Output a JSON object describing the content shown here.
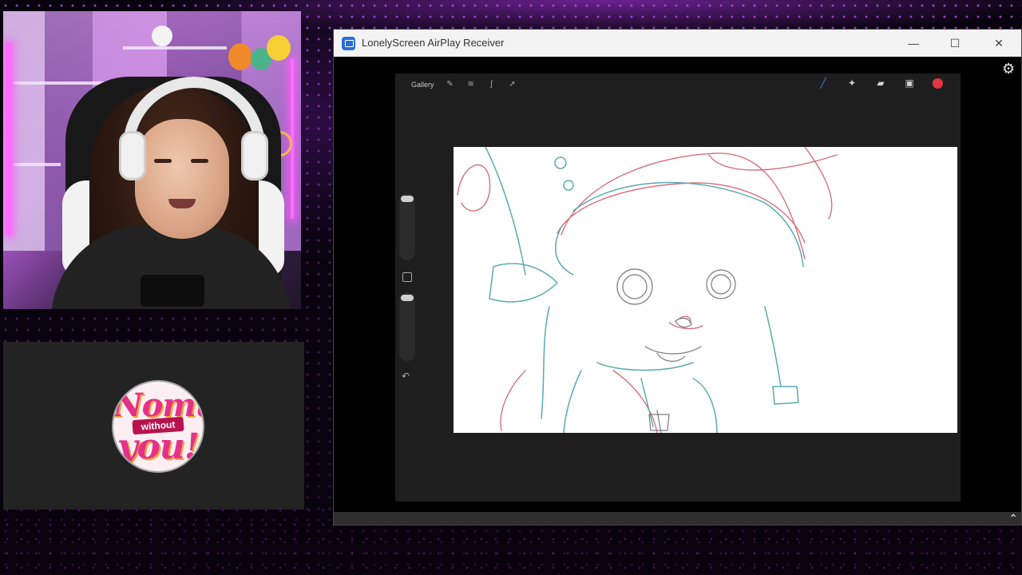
{
  "window": {
    "title": "LonelyScreen AirPlay Receiver",
    "controls": {
      "minimize": "—",
      "maximize": "☐",
      "close": "✕"
    }
  },
  "procreate": {
    "gallery_label": "Gallery",
    "selected_color": "#e2363e",
    "accent_color": "#3d7be8"
  },
  "logo": {
    "top": "Nomu",
    "middle": "without",
    "bottom": "you!"
  },
  "icons": {
    "settings": "⚙",
    "chevron_up": "⌃",
    "undo": "↶"
  }
}
